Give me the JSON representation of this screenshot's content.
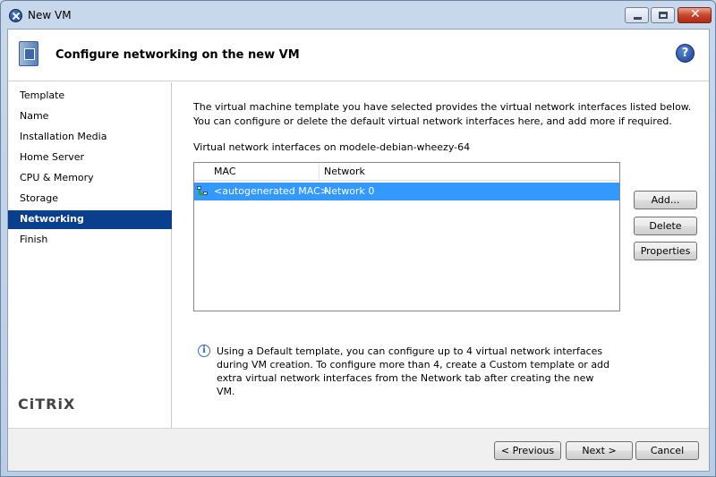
{
  "window": {
    "title": "New VM"
  },
  "header": {
    "title": "Configure networking on the new VM",
    "help_glyph": "?"
  },
  "sidebar": {
    "items": [
      {
        "label": "Template",
        "active": false
      },
      {
        "label": "Name",
        "active": false
      },
      {
        "label": "Installation Media",
        "active": false
      },
      {
        "label": "Home Server",
        "active": false
      },
      {
        "label": "CPU & Memory",
        "active": false
      },
      {
        "label": "Storage",
        "active": false
      },
      {
        "label": "Networking",
        "active": true
      },
      {
        "label": "Finish",
        "active": false
      }
    ],
    "logo": "CiTRiX"
  },
  "main": {
    "intro": "The virtual machine template you have selected provides the virtual network interfaces listed below. You can configure or delete the default virtual network interfaces here, and add more if required.",
    "list_label": "Virtual network interfaces on modele-debian-wheezy-64",
    "columns": [
      "MAC",
      "Network"
    ],
    "rows": [
      {
        "mac": "<autogenerated MAC>",
        "network": "Network 0",
        "selected": true
      }
    ],
    "buttons": {
      "add": "Add...",
      "delete": "Delete",
      "properties": "Properties"
    },
    "info": "Using a Default template, you can configure up to 4 virtual network interfaces during VM creation. To configure more than 4, create a Custom template or add extra virtual network interfaces from the Network tab after creating the new VM."
  },
  "footer": {
    "previous": "< Previous",
    "next": "Next >",
    "cancel": "Cancel"
  },
  "colors": {
    "selected_nav": "#0a3f8f",
    "selected_row": "#3399ff"
  }
}
